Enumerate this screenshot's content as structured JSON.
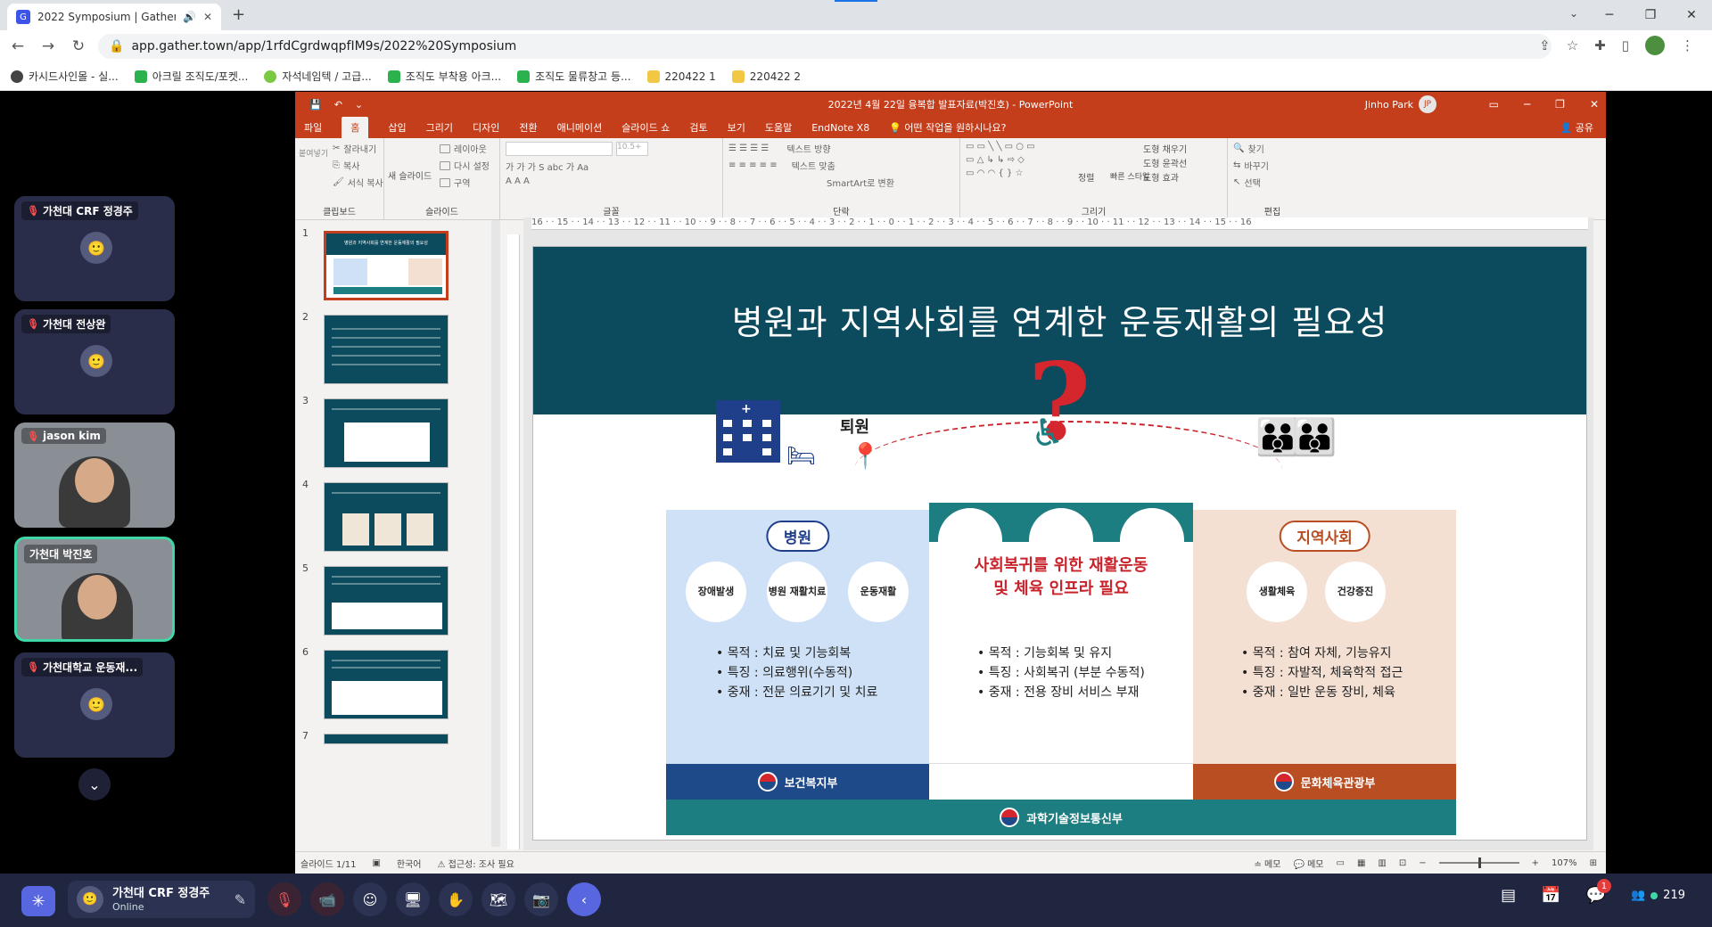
{
  "browser": {
    "tab_title": "2022 Symposium | Gather",
    "url": "app.gather.town/app/1rfdCgrdwqpfIM9s/2022%20Symposium",
    "bookmarks": [
      "카시드사인몰 - 실...",
      "아크릴 조직도/포켓...",
      "자석네임텍 / 고급...",
      "조직도 부착용 아크...",
      "조직도 물류창고 등...",
      "220422 1",
      "220422 2"
    ]
  },
  "sidebar": {
    "participants": [
      {
        "name": "가천대 CRF 정경주",
        "muted": true
      },
      {
        "name": "가천대 전상완",
        "muted": true
      },
      {
        "name": "jason kim",
        "muted": true
      },
      {
        "name": "가천대 박진호",
        "muted": false
      },
      {
        "name": "가천대학교 운동재...",
        "muted": true
      }
    ]
  },
  "powerpoint": {
    "window_title": "2022년 4월 22일 융복합 발표자료(박진호) - PowerPoint",
    "user_name": "Jinho Park",
    "user_initials": "JP",
    "tabs": [
      "파일",
      "홈",
      "삽입",
      "그리기",
      "디자인",
      "전환",
      "애니메이션",
      "슬라이드 쇼",
      "검토",
      "보기",
      "도움말",
      "EndNote X8"
    ],
    "tell_me": "어떤 작업을 원하시나요?",
    "share": "공유",
    "ribbon": {
      "clipboard": {
        "label": "클립보드",
        "paste": "붙여넣기",
        "cut": "잘라내기",
        "copy": "복사",
        "format_painter": "서식 복사"
      },
      "slides": {
        "label": "슬라이드",
        "new_slide": "새 슬라이드",
        "layout": "레이아웃",
        "reset": "다시 설정",
        "section": "구역"
      },
      "font": {
        "label": "글꼴",
        "size": "10.5+"
      },
      "paragraph": {
        "label": "단락",
        "text_direction": "텍스트 방향",
        "align_text": "텍스트 맞춤",
        "smartart": "SmartArt로 변환"
      },
      "drawing": {
        "label": "그리기",
        "arrange": "정렬",
        "quick_styles": "빠른 스타일",
        "fill": "도형 채우기",
        "outline": "도형 윤곽선",
        "effects": "도형 효과"
      },
      "editing": {
        "label": "편집",
        "find": "찾기",
        "replace": "바꾸기",
        "select": "선택"
      }
    },
    "thumbnails": [
      "1",
      "2",
      "3",
      "4",
      "5",
      "6",
      "7"
    ],
    "thumb1_title": "병원과 지역사회를 연계한 운동재활의 필요성",
    "slide": {
      "title": "병원과 지역사회를 연계한 운동재활의 필요성",
      "qmark": "?",
      "exit_label": "퇴원",
      "hospital": {
        "pill": "병원",
        "circles": [
          "장애발생",
          "병원 재활치료",
          "운동재활"
        ],
        "bullets": [
          "• 목적 : 치료 및 기능회복",
          "• 특징 : 의료행위(수동적)",
          "• 중재 : 전문 의료기기 및 치료"
        ]
      },
      "middle": {
        "heading_line1": "사회복귀를 위한 재활운동",
        "heading_line2": "및 체육 인프라 필요",
        "bullets": [
          "• 목적 : 기능회복 및 유지",
          "• 특징 : 사회복귀 (부분 수동적)",
          "• 중재 : 전용 장비 서비스 부재"
        ]
      },
      "community": {
        "pill": "지역사회",
        "circles": [
          "생활체육",
          "건강증진"
        ],
        "bullets": [
          "• 목적 : 참여 자체, 기능유지",
          "• 특징 : 자발적, 체육학적 접근",
          "• 중재 : 일반 운동 장비, 체육"
        ]
      },
      "ministry_health": "보건복지부",
      "ministry_culture": "문화체육관광부",
      "ministry_science": "과학기술정보통신부"
    },
    "ruler_labels": [
      "16",
      "15",
      "14",
      "13",
      "12",
      "11",
      "10",
      "9",
      "8",
      "7",
      "6",
      "5",
      "4",
      "3",
      "2",
      "1",
      "0",
      "1",
      "2",
      "3",
      "4",
      "5",
      "6",
      "7",
      "8",
      "9",
      "10",
      "11",
      "12",
      "13",
      "14",
      "15",
      "16"
    ],
    "statusbar": {
      "slide_info": "슬라이드 1/11",
      "language": "한국어",
      "accessibility": "접근성: 조사 필요",
      "notes": "메모",
      "comments": "메모",
      "zoom": "107%"
    }
  },
  "bottombar": {
    "user_name": "가천대 CRF 정경주",
    "status": "Online",
    "online_count": "219",
    "chat_badge": "1"
  }
}
